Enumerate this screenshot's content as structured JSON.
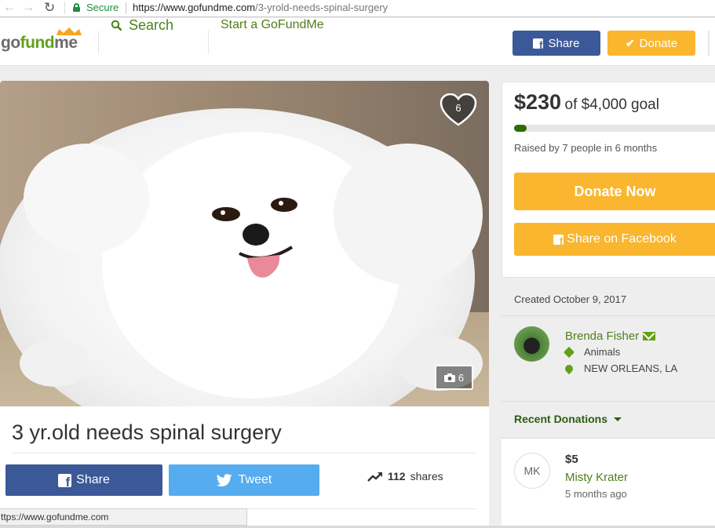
{
  "browser": {
    "secure_label": "Secure",
    "url_host": "https://www.gofundme.com",
    "url_path": "/3-yrold-needs-spinal-surgery",
    "status_url": "ttps://www.gofundme.com",
    "icons": [
      "back-arrow-icon",
      "forward-arrow-icon",
      "reload-icon",
      "lock-icon"
    ]
  },
  "header": {
    "logo_go": "go",
    "logo_fund": "fund",
    "logo_me": "me",
    "search_label": "Search",
    "start_label": "Start a GoFundMe",
    "share_label": "Share",
    "donate_label": "Donate",
    "colors": {
      "brand_green": "#63a019",
      "facebook_blue": "#3b5998",
      "donate_orange": "#f9b62e"
    }
  },
  "campaign": {
    "heart_count": "6",
    "photo_count": "6",
    "title": "3 yr.old needs spinal surgery",
    "share_label": "Share",
    "tweet_label": "Tweet",
    "shares_count": "112",
    "shares_label": "shares",
    "twitter_color": "#55acee"
  },
  "donate_card": {
    "raised_amount": "$230",
    "goal_text": "of $4,000 goal",
    "progress_fraction": 0.0575,
    "raised_by": "Raised by 7 people in 6 months",
    "donate_now_label": "Donate Now",
    "share_fb_label": "Share on Facebook"
  },
  "organizer": {
    "created": "Created October 9, 2017",
    "name": "Brenda Fisher",
    "category": "Animals",
    "location": "NEW ORLEANS, LA"
  },
  "donations": {
    "heading": "Recent Donations",
    "items": [
      {
        "initials": "MK",
        "amount": "$5",
        "name": "Misty Krater",
        "time": "5 months ago"
      }
    ]
  }
}
